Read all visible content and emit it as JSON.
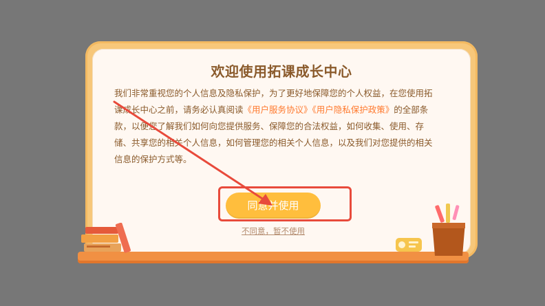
{
  "dialog": {
    "title": "欢迎使用拓课成长中心",
    "body_part1": "我们非常重视您的个人信息及隐私保护，为了更好地保障您的个人权益，在您使用拓课成长中心之前，请务必认真阅读",
    "link_service": "《用户服务协议》",
    "link_privacy": "《用户隐私保护政策》",
    "body_part2": "的全部条款，以便您了解我们如何向您提供服务、保障您的合法权益，如何收集、使用、存储、共享您的相关个人信息，如何管理您的相关个人信息，以及我们对您提供的相关信息的保护方式等。",
    "agree_label": "同意并使用",
    "decline_label": "不同意，暂不使用"
  },
  "colors": {
    "accent": "#ffbe3d",
    "text": "#8a5a2b",
    "link": "#ff7a2f",
    "annotation": "#e84a3b",
    "background_overlay": "#777777"
  },
  "icons": {
    "books": "books-illustration",
    "pencil_cup": "pencil-cup-illustration",
    "radio": "radio-illustration",
    "arrow": "annotation-arrow"
  }
}
